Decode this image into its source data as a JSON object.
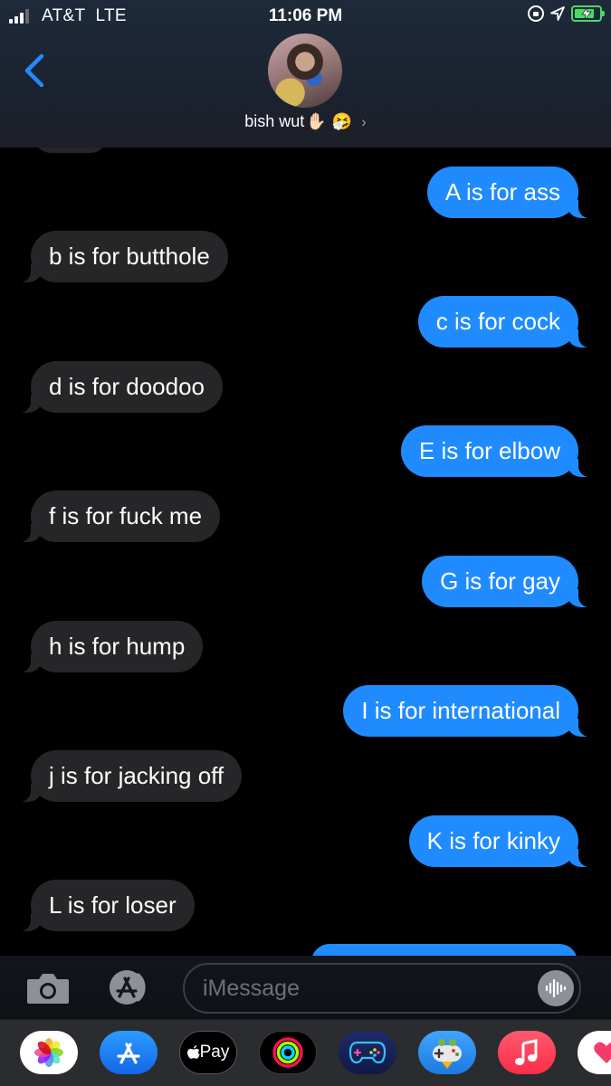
{
  "status_bar": {
    "carrier": "AT&T",
    "network": "LTE",
    "time": "11:06 PM"
  },
  "header": {
    "contact_name": "bish wut",
    "contact_emoji_1": "✋🏻",
    "contact_emoji_2": "🤧",
    "back_icon": "chevron-left-icon",
    "chevron": "›"
  },
  "messages": [
    {
      "direction": "outgoing",
      "text": "A is for ass"
    },
    {
      "direction": "incoming",
      "text": "b is for butthole"
    },
    {
      "direction": "outgoing",
      "text": "c is for cock"
    },
    {
      "direction": "incoming",
      "text": "d is for doodoo"
    },
    {
      "direction": "outgoing",
      "text": "E is for elbow"
    },
    {
      "direction": "incoming",
      "text": "f is for fuck me"
    },
    {
      "direction": "outgoing",
      "text": "G is for gay"
    },
    {
      "direction": "incoming",
      "text": "h is for hump"
    },
    {
      "direction": "outgoing",
      "text": "I is for international"
    },
    {
      "direction": "incoming",
      "text": "j is for jacking off"
    },
    {
      "direction": "outgoing",
      "text": "K is for kinky"
    },
    {
      "direction": "incoming",
      "text": "L is for loser"
    }
  ],
  "compose": {
    "placeholder": "iMessage",
    "camera_icon": "camera-icon",
    "apps_icon": "app-store-icon",
    "audio_icon": "audio-waveform-icon"
  },
  "app_drawer": {
    "pay_label": "Pay",
    "apps": [
      "photos-icon",
      "app-store-icon",
      "apple-pay-icon",
      "activity-icon",
      "game-controller-icon",
      "game-pigeon-icon",
      "music-icon",
      "digital-touch-icon"
    ]
  },
  "colors": {
    "outgoing_bubble": "#1f8bff",
    "incoming_bubble": "#262628",
    "accent": "#1f8bff",
    "battery": "#4cd964"
  }
}
